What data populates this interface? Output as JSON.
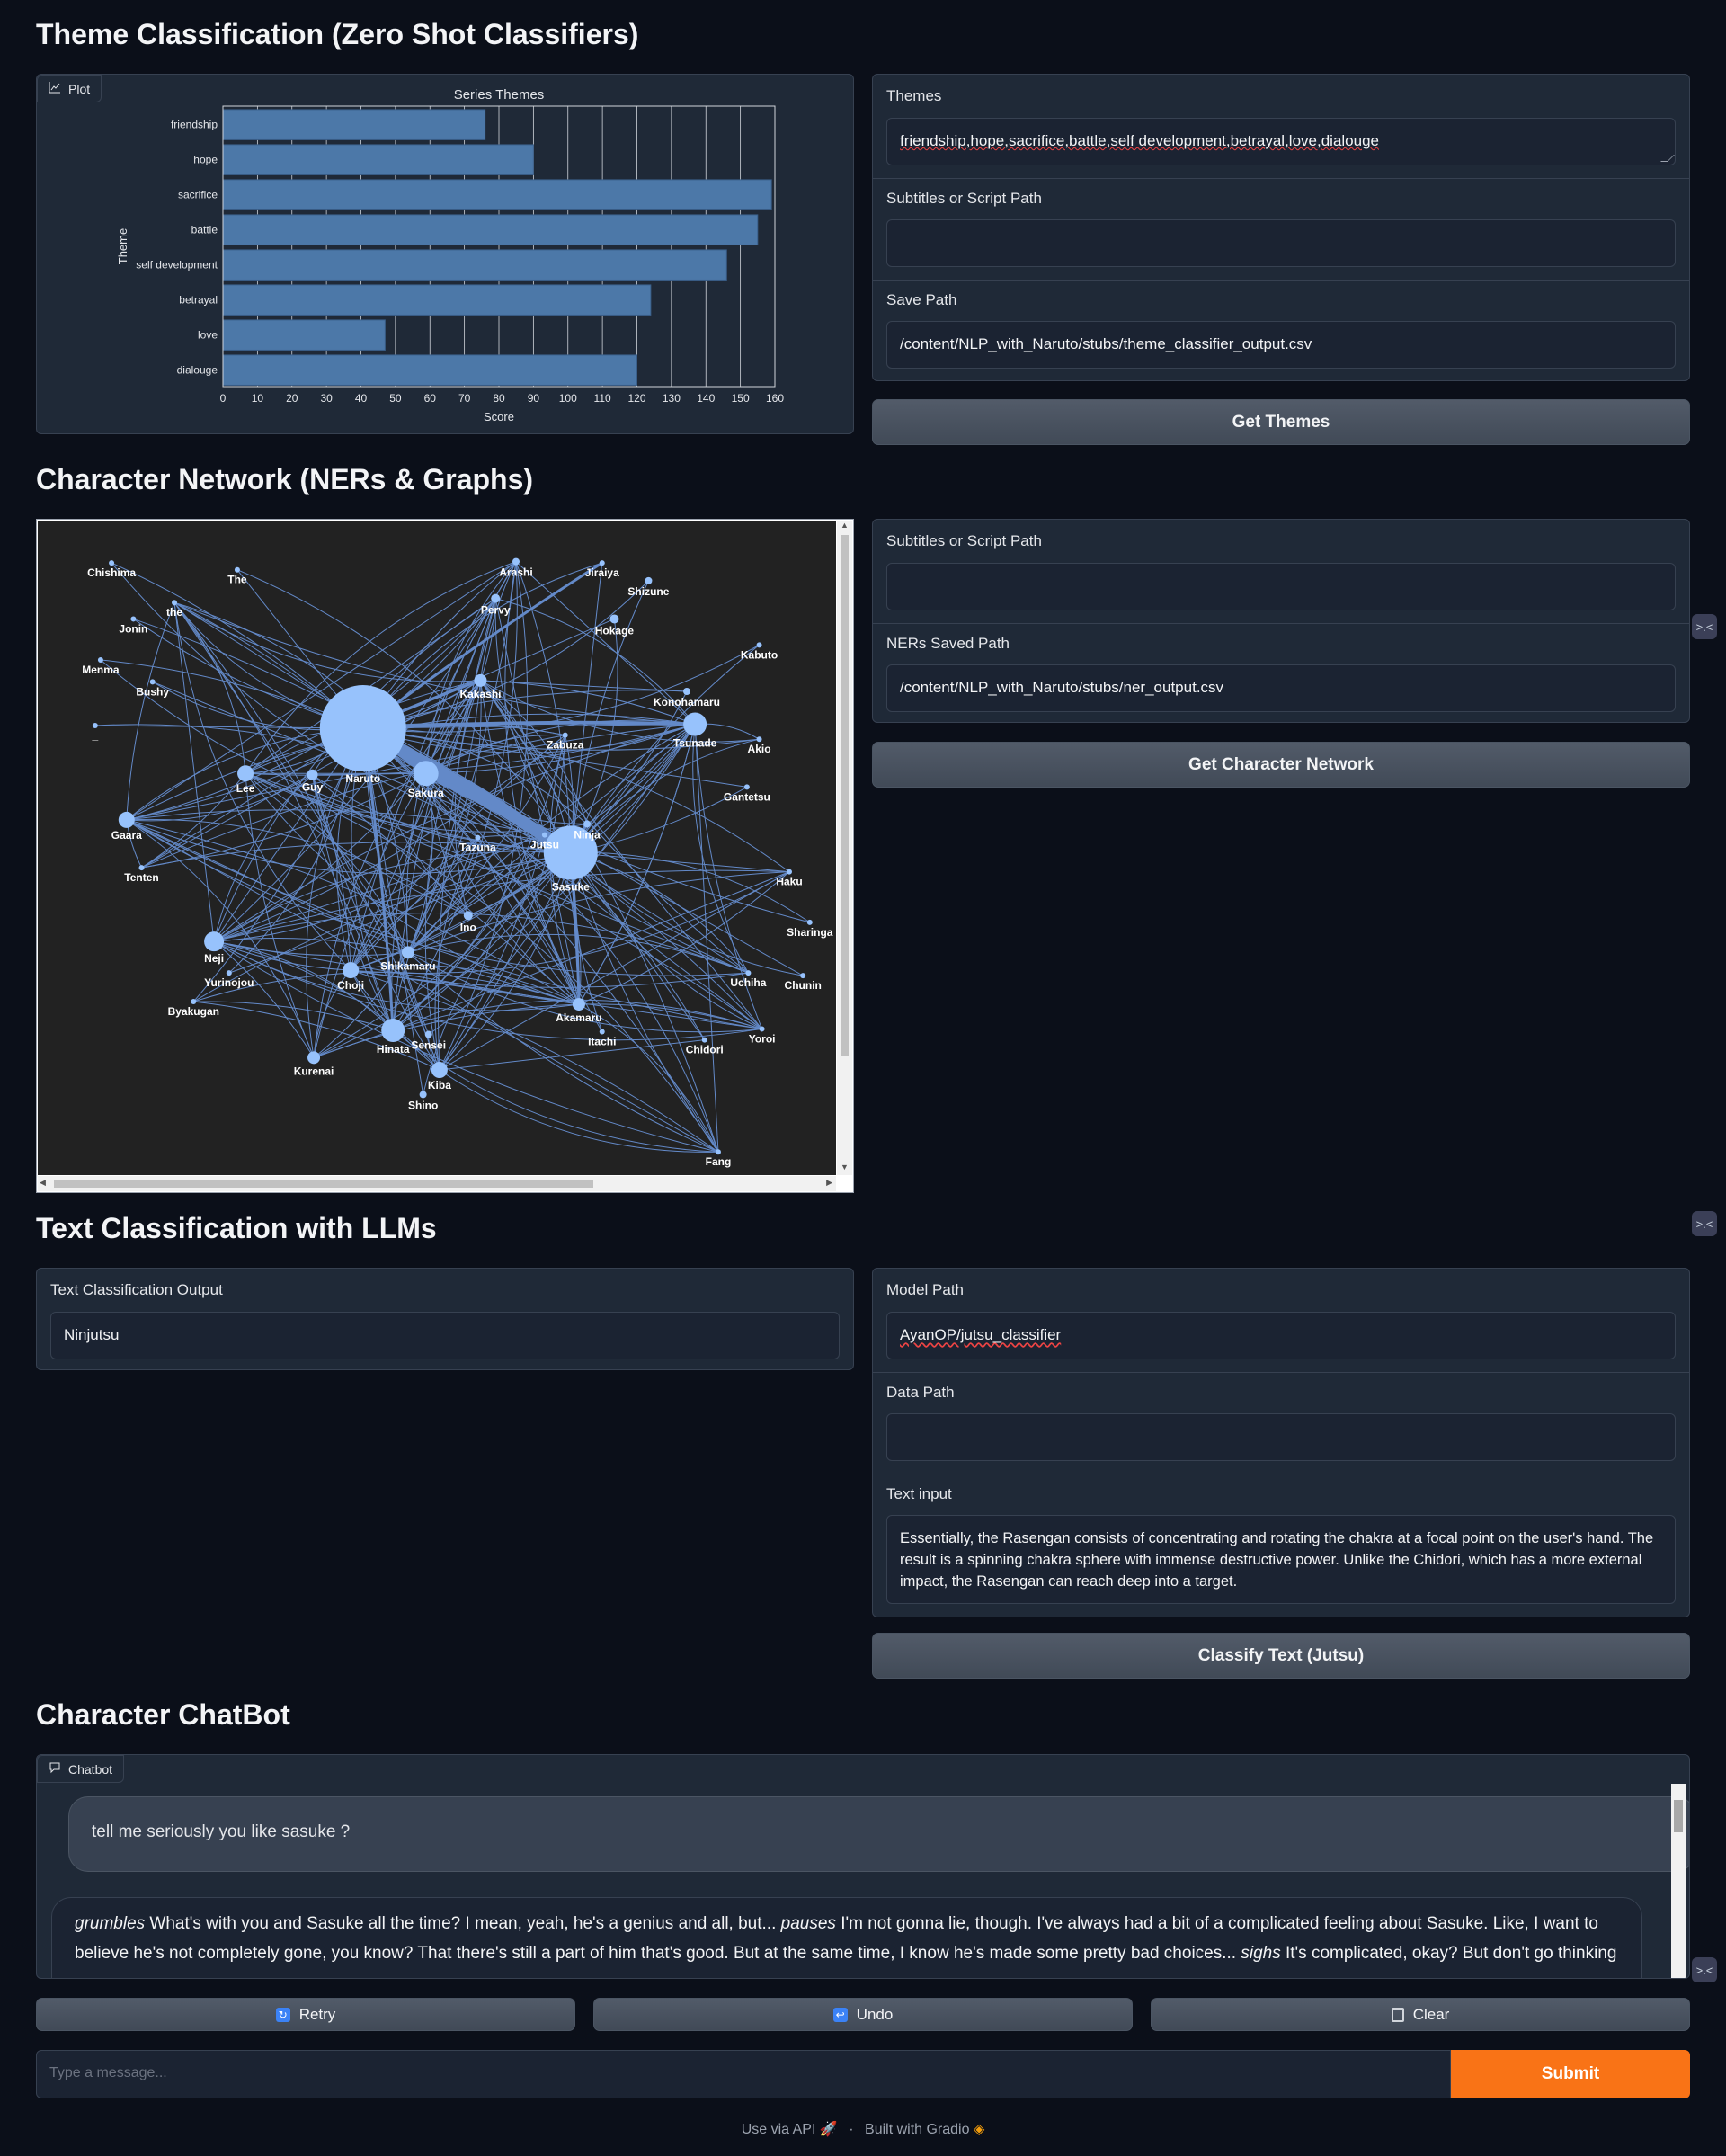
{
  "sections": {
    "theme": "Theme Classification (Zero Shot Classifiers)",
    "network": "Character Network (NERs & Graphs)",
    "text_cls": "Text Classification with LLMs",
    "chatbot": "Character ChatBot"
  },
  "theme_panel": {
    "plot_tag": "Plot",
    "themes_label": "Themes",
    "themes_value": "friendship,hope,sacrifice,battle,self development,betrayal,love,dialouge",
    "subs_label": "Subtitles or Script Path",
    "subs_value": "",
    "save_label": "Save Path",
    "save_value": "/content/NLP_with_Naruto/stubs/theme_classifier_output.csv",
    "button": "Get Themes"
  },
  "chart_data": {
    "type": "bar",
    "orientation": "horizontal",
    "title": "Series Themes",
    "xlabel": "Score",
    "ylabel": "Theme",
    "categories": [
      "friendship",
      "hope",
      "sacrifice",
      "battle",
      "self development",
      "betrayal",
      "love",
      "dialouge"
    ],
    "values": [
      76,
      90,
      159,
      155,
      146,
      124,
      47,
      120
    ],
    "xlim": [
      0,
      160
    ],
    "xticks": [
      0,
      10,
      20,
      30,
      40,
      50,
      60,
      70,
      80,
      90,
      100,
      110,
      120,
      130,
      140,
      150,
      160
    ],
    "grid": true,
    "bar_color": "#4c78a8"
  },
  "network_panel": {
    "subs_label": "Subtitles or Script Path",
    "subs_value": "",
    "ners_label": "NERs Saved Path",
    "ners_value": "/content/NLP_with_Naruto/stubs/ner_output.csv",
    "button": "Get Character Network",
    "nodes": [
      "Chishima",
      "The",
      "Arashi",
      "Jiraiya",
      "Shizune",
      "Pervy",
      "Hokage",
      "Jonin",
      "the",
      "Kabuto",
      "Menma",
      "Kakashi",
      "Konohamaru",
      "Bushy",
      "Tsunade",
      "Akio",
      "_",
      "Zabuza",
      "Naruto",
      "Lee",
      "Guy",
      "Sakura",
      "Gantetsu",
      "Jutsu",
      "Ninja",
      "Gaara",
      "Tazuna",
      "Tenten",
      "Sasuke",
      "Haku",
      "Ino",
      "Sharinga",
      "Neji",
      "Shikamaru",
      "Yurinojou",
      "Choji",
      "Uchiha",
      "Chunin",
      "Byakugan",
      "Akamaru",
      "Hinata",
      "Sensei",
      "Yoroi",
      "Itachi",
      "Chidori",
      "Kurenai",
      "Kiba",
      "Shino",
      "Fang"
    ]
  },
  "text_cls": {
    "output_label": "Text Classification Output",
    "output_value": "Ninjutsu",
    "model_label": "Model Path",
    "model_value": "AyanOP/jutsu_classifier",
    "data_label": "Data Path",
    "data_value": "",
    "text_label": "Text input",
    "text_value": "Essentially, the Rasengan consists of concentrating and rotating the chakra at a focal point on the user's hand. The result is a spinning chakra sphere with immense destructive power. Unlike the Chidori, which has a more external impact, the Rasengan can reach deep into a target.",
    "button": "Classify Text (Jutsu)"
  },
  "chatbot": {
    "tag": "Chatbot",
    "user_msg": "tell me seriously you like sasuke ?",
    "bot_msg_1_em": "grumbles",
    "bot_msg_1": " What's with you and Sasuke all the time? I mean, yeah, he's a genius and all, but... ",
    "bot_msg_2_em": "pauses",
    "bot_msg_2": " I'm not gonna lie, though. I've always had a bit of a complicated feeling about Sasuke. Like, I want to believe he's not completely gone, you know? That there's still a part of him that's good. But at the same time, I know he's made some pretty bad choices... ",
    "bot_msg_3_em": "sighs",
    "bot_msg_3": " It's complicated, okay? But don't go thinking",
    "retry": "Retry",
    "undo": "Undo",
    "clear": "Clear",
    "placeholder": "Type a message...",
    "submit": "Submit"
  },
  "footer": {
    "api": "Use via API",
    "sep": "·",
    "built": "Built with Gradio"
  },
  "colors": {
    "accent": "#f97316",
    "bar": "#4c78a8",
    "network_edge": "#6f9ce6",
    "network_node": "#97c2fc"
  }
}
